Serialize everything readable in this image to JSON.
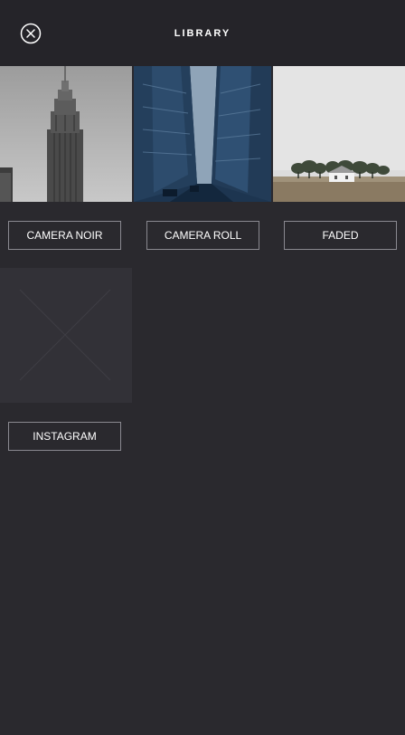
{
  "header": {
    "title": "LIBRARY",
    "close_icon": "close-circle-icon"
  },
  "albums": [
    {
      "label": "CAMERA NOIR",
      "thumbnail": "empire-state-building-bw-photo"
    },
    {
      "label": "CAMERA ROLL",
      "thumbnail": "city-street-blue-tint-photo"
    },
    {
      "label": "FADED",
      "thumbnail": "field-house-trees-photo"
    },
    {
      "label": "INSTAGRAM",
      "thumbnail": "placeholder-image"
    }
  ],
  "colors": {
    "background": "#2a292e",
    "header": "#252429",
    "button_border": "#8a8990",
    "placeholder": "#323137"
  }
}
